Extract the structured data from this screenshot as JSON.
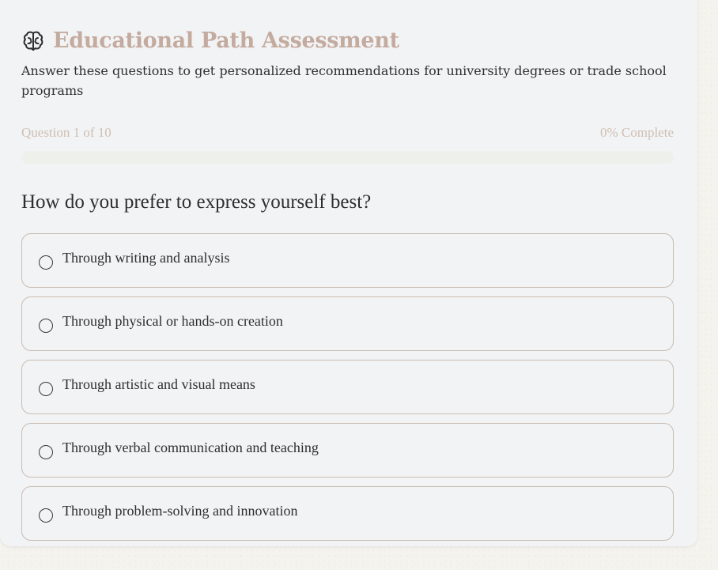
{
  "header": {
    "icon": "brain-icon",
    "title": "Educational Path Assessment",
    "subtitle": "Answer these questions to get personalized recommendations for university degrees or trade school programs"
  },
  "progress": {
    "question_label": "Question 1 of 10",
    "complete_label": "0% Complete",
    "fraction": 0
  },
  "question": {
    "text": "How do you prefer to express yourself best?",
    "options": [
      {
        "label": "Through writing and analysis"
      },
      {
        "label": "Through physical or hands-on creation"
      },
      {
        "label": "Through artistic and visual means"
      },
      {
        "label": "Through verbal communication and teaching"
      },
      {
        "label": "Through problem-solving and innovation"
      }
    ]
  },
  "colors": {
    "accent": "#c4ab9f",
    "card_background": "#f2f3f5",
    "option_border": "#c9bcb1",
    "muted_text": "#cfbfb3"
  }
}
